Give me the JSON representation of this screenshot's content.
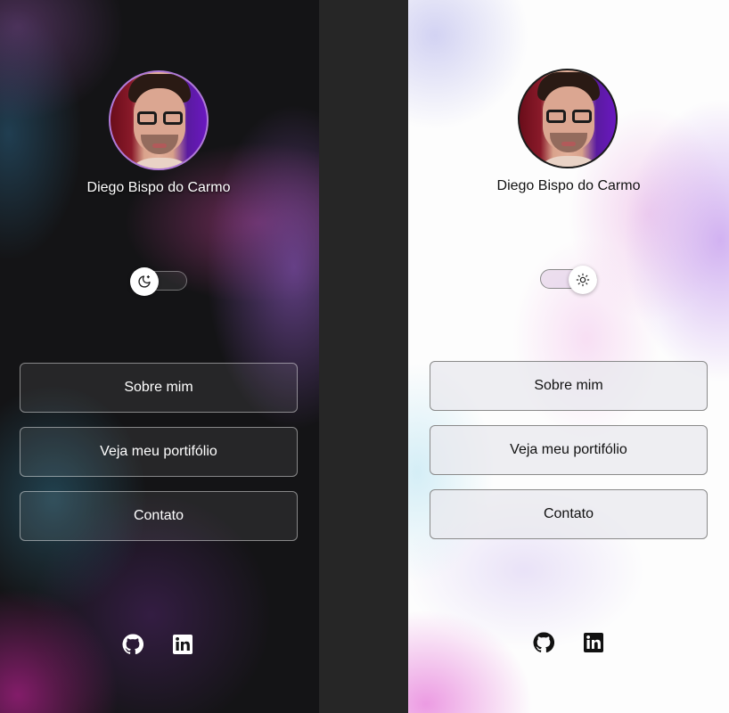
{
  "dark_panel": {
    "name": "Diego Bispo do Carmo",
    "theme_toggle": {
      "state": "dark",
      "knob_icon": "moon-icon"
    },
    "buttons": [
      {
        "label": "Sobre mim"
      },
      {
        "label": "Veja meu portifólio"
      },
      {
        "label": "Contato"
      }
    ],
    "social": [
      "github-icon",
      "linkedin-icon"
    ]
  },
  "light_panel": {
    "name": "Diego Bispo do Carmo",
    "theme_toggle": {
      "state": "light",
      "knob_icon": "sun-icon"
    },
    "buttons": [
      {
        "label": "Sobre mim"
      },
      {
        "label": "Veja meu portifólio"
      },
      {
        "label": "Contato"
      }
    ],
    "social": [
      "github-icon",
      "linkedin-icon"
    ]
  },
  "colors": {
    "dark_bg": "#141416",
    "light_bg": "#fdfdfd",
    "divider": "#262626",
    "accent_purple": "#6a18c0",
    "accent_pink": "#e896e0"
  }
}
